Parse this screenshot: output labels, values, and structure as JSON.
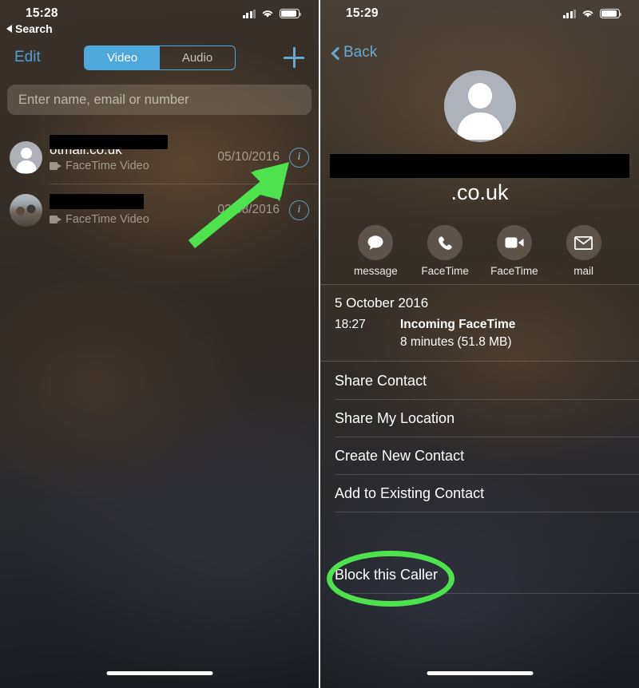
{
  "left_panel": {
    "status_bar": {
      "time": "15:28",
      "signal_icon": "cellular-signal-icon",
      "wifi_icon": "wifi-icon",
      "battery_icon": "battery-icon"
    },
    "back_label": "Search",
    "toolbar": {
      "edit_label": "Edit",
      "add_label": "+",
      "segments": [
        {
          "label": "Video",
          "selected": true
        },
        {
          "label": "Audio",
          "selected": false
        }
      ]
    },
    "search": {
      "placeholder": "Enter name, email or number",
      "value": ""
    },
    "calls": [
      {
        "name_redacted": true,
        "name_visible": "otmail.co.uk",
        "type": "FaceTime Video",
        "date": "05/10/2016",
        "avatar": "default-person-avatar",
        "info_label": "i"
      },
      {
        "name_redacted": true,
        "name_visible": "",
        "type": "FaceTime Video",
        "date": "0?/08/2016",
        "avatar": "photo-avatar",
        "info_label": "i"
      }
    ],
    "annotation": {
      "type": "green-arrow",
      "points_at": "info-button-row-1",
      "color": "#4EE24E"
    }
  },
  "right_panel": {
    "status_bar": {
      "time": "15:29",
      "signal_icon": "cellular-signal-icon",
      "wifi_icon": "wifi-icon",
      "battery_icon": "battery-icon"
    },
    "back_label": "Back",
    "contact": {
      "avatar": "default-person-avatar",
      "name_redacted": true,
      "name_line2": ".co.uk"
    },
    "actions": [
      {
        "label": "message",
        "icon": "message-bubble-icon"
      },
      {
        "label": "FaceTime",
        "icon": "phone-icon"
      },
      {
        "label": "FaceTime",
        "icon": "video-camera-icon"
      },
      {
        "label": "mail",
        "icon": "envelope-icon"
      }
    ],
    "call_info": {
      "date": "5 October 2016",
      "time": "18:27",
      "kind": "Incoming FaceTime",
      "duration": "8 minutes (51.8 MB)"
    },
    "menu_items": [
      "Share Contact",
      "Share My Location",
      "Create New Contact",
      "Add to Existing Contact"
    ],
    "block_item": "Block this Caller",
    "annotation": {
      "type": "green-ellipse",
      "highlights": "Block this Caller",
      "color": "#4EE24E"
    }
  }
}
